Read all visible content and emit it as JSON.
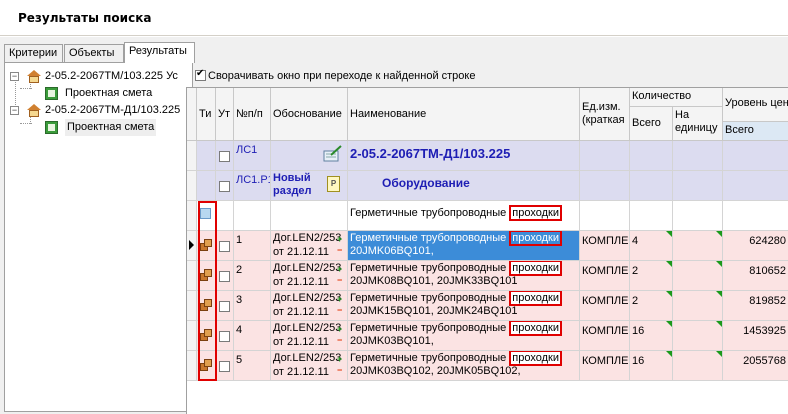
{
  "window": {
    "title": "Результаты поиска"
  },
  "tabs": [
    {
      "label": "Критерии"
    },
    {
      "label": "Объекты"
    },
    {
      "label": "Результаты"
    }
  ],
  "tree": [
    {
      "label": "2-05.2-2067ТМ/103.225 Ус",
      "icon": "house-icon"
    },
    {
      "label": "Проектная смета",
      "icon": "estimate-sheet-icon"
    },
    {
      "label": "2-05.2-2067ТМ-Д1/103.225",
      "icon": "house-icon"
    },
    {
      "label": "Проектная смета",
      "icon": "estimate-sheet-icon"
    }
  ],
  "options": {
    "collapse_label": "Сворачивать окно при переходе к найденной строке",
    "collapse_checked": true
  },
  "columns": {
    "ti": "Ти",
    "ut": "Ут",
    "num": "№п/п",
    "basis": "Обоснование",
    "name": "Наименование",
    "unit": "Ед.изм. (краткая",
    "qty": "Количество",
    "qty_total": "Всего",
    "qty_per_unit": "На единицу",
    "price_level": "Уровень цен",
    "price_total": "Всего"
  },
  "rows": [
    {
      "type": "section",
      "num": "ЛС1",
      "name": "2-05.2-2067ТМ-Д1/103.225"
    },
    {
      "type": "subsection",
      "num": "ЛС1.Р1",
      "basis_1": "Новый",
      "basis_2": "раздел",
      "name": "Оборудование"
    },
    {
      "type": "group",
      "name_pre": "Герметичные трубопроводные",
      "name_kw": "проходки"
    },
    {
      "type": "item",
      "num": "1",
      "basis_1": "Дог.LEN2/253",
      "basis_2": "от 21.12.11",
      "name_pre": "Герметичные трубопроводные",
      "name_kw": "проходки",
      "name_2": "20JMK06BQ101,",
      "unit": "КОМПЛЕ",
      "qty": "4",
      "price": "624280",
      "selected": true
    },
    {
      "type": "item",
      "num": "2",
      "basis_1": "Дог.LEN2/253",
      "basis_2": "от 21.12.11",
      "name_pre": "Герметичные трубопроводные",
      "name_kw": "проходки",
      "name_2": "20JMK08BQ101, 20JMK33BQ101",
      "unit": "КОМПЛЕ",
      "qty": "2",
      "price": "810652"
    },
    {
      "type": "item",
      "num": "3",
      "basis_1": "Дог.LEN2/253",
      "basis_2": "от 21.12.11",
      "name_pre": "Герметичные трубопроводные",
      "name_kw": "проходки",
      "name_2": "20JMK15BQ101, 20JMK24BQ101",
      "unit": "КОМПЛЕ",
      "qty": "2",
      "price": "819852"
    },
    {
      "type": "item",
      "num": "4",
      "basis_1": "Дог.LEN2/253",
      "basis_2": "от 21.12.11",
      "name_pre": "Герметичные трубопроводные",
      "name_kw": "проходки",
      "name_2": "20JMK03BQ101,",
      "unit": "КОМПЛЕ",
      "qty": "16",
      "price": "1453925"
    },
    {
      "type": "item",
      "num": "5",
      "basis_1": "Дог.LEN2/253",
      "basis_2": "от 21.12.11",
      "name_pre": "Герметичные трубопроводные",
      "name_kw": "проходки",
      "name_2": "20JMK03BQ102, 20JMK05BQ102,",
      "unit": "КОМПЛЕ",
      "qty": "16",
      "price": "2055768"
    }
  ],
  "colors": {
    "item_row_bg": "#fbe3e3",
    "section_bg": "#dcdcf0",
    "highlight_border": "#e00000",
    "selected_cell": "#3c8cd8"
  }
}
